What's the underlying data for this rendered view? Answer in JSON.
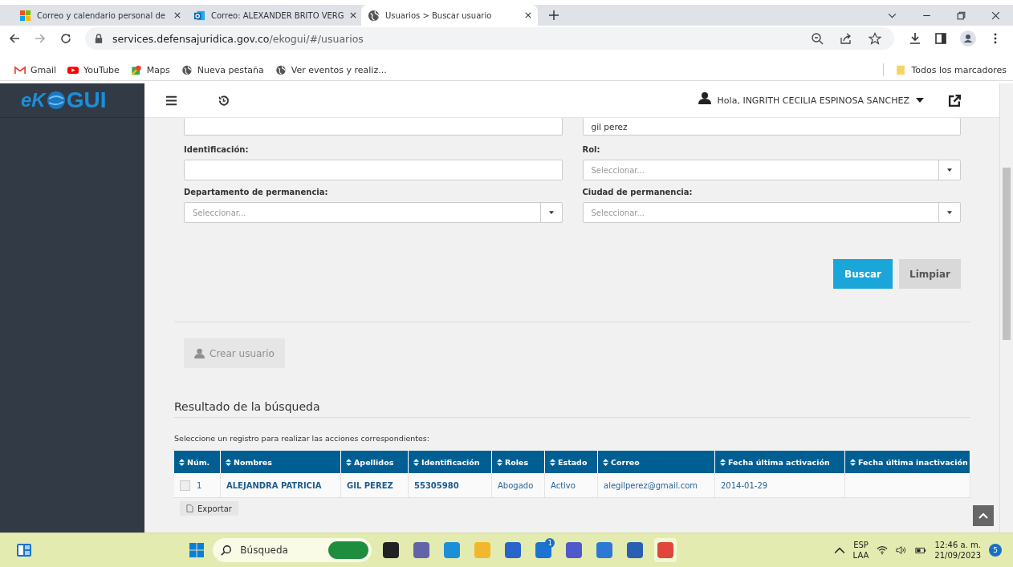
{
  "browser": {
    "tabs": [
      {
        "title": "Correo y calendario personal de",
        "selected": false,
        "kind": "microsoft"
      },
      {
        "title": "Correo: ALEXANDER BRITO VERG",
        "selected": false,
        "kind": "outlook"
      },
      {
        "title": "Usuarios > Buscar usuario",
        "selected": true,
        "kind": "globe"
      }
    ],
    "url_host": "services.defensajuridica.gov.co",
    "url_path": "/ekogui/#/usuarios",
    "bookmarks": [
      {
        "label": "Gmail",
        "kind": "gmail"
      },
      {
        "label": "YouTube",
        "kind": "youtube"
      },
      {
        "label": "Maps",
        "kind": "maps"
      },
      {
        "label": "Nueva pestaña",
        "kind": "globe"
      },
      {
        "label": "Ver eventos y realiz...",
        "kind": "globe"
      }
    ],
    "all_bookmarks": "Todos los marcadores"
  },
  "app": {
    "logo": {
      "left": "eK",
      "right": "GUI"
    },
    "greeting": "Hola, INGRITH CECILIA ESPINOSA SANCHEZ",
    "top_fields": [
      {
        "kind": "text"
      },
      {
        "kind": "text",
        "value": "gil perez"
      }
    ],
    "fields": [
      {
        "label": "Identificación:",
        "kind": "text"
      },
      {
        "label": "Rol:",
        "kind": "select",
        "placeholder": "Seleccionar..."
      },
      {
        "label": "Departamento de permanencia:",
        "kind": "select",
        "placeholder": "Seleccionar..."
      },
      {
        "label": "Ciudad de permanencia:",
        "kind": "select",
        "placeholder": "Seleccionar..."
      }
    ],
    "search_button": "Buscar",
    "clear_button": "Limpiar",
    "create_user": {
      "label": "Crear usuario",
      "disabled": true
    },
    "results_title": "Resultado de la búsqueda",
    "instruction": "Seleccione un registro para realizar las acciones correspondientes:",
    "table": {
      "columns": [
        "Núm.",
        "Nombres",
        "Apellidos",
        "Identificación",
        "Roles",
        "Estado",
        "Correo",
        "Fecha última activación",
        "Fecha última inactivación"
      ],
      "rows": [
        {
          "checked": false,
          "cells": [
            "1",
            "ALEJANDRA PATRICIA",
            "GIL PEREZ",
            "55305980",
            "Abogado",
            "Activo",
            "alegilperez@gmail.com",
            "2014-01-29"
          ]
        }
      ]
    },
    "export_button": "Exportar"
  },
  "taskbar": {
    "search_placeholder": "Búsqueda",
    "apps": [
      {
        "kind": "files"
      },
      {
        "kind": "teams"
      },
      {
        "kind": "edge"
      },
      {
        "kind": "folder"
      },
      {
        "kind": "store"
      },
      {
        "kind": "mail",
        "badge": "1"
      },
      {
        "kind": "teams2"
      },
      {
        "kind": "shield"
      },
      {
        "kind": "word"
      },
      {
        "kind": "chrome",
        "selected": true
      }
    ],
    "language": "ESP",
    "layout": "LAA",
    "time": "12:46 a. m.",
    "date": "21/09/2023",
    "notifications": "5"
  }
}
